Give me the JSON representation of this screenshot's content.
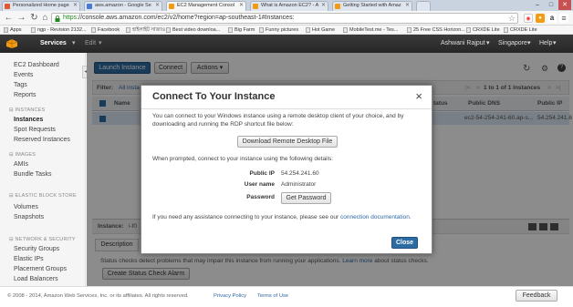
{
  "browser": {
    "tabs": [
      {
        "label": "Personalized Home page",
        "color": "#e6562f"
      },
      {
        "label": "aws.amazon - Google Se",
        "color": "#4a7bd4"
      },
      {
        "label": "EC2 Management Consol",
        "color": "#f39c12"
      },
      {
        "label": "What is Amazon EC2? - A",
        "color": "#f39c12"
      },
      {
        "label": "Getting Started with Amaz",
        "color": "#f39c12"
      }
    ],
    "window_controls": [
      "–",
      "□",
      "✕"
    ],
    "url_scheme": "https",
    "url_rest": "://console.aws.amazon.com/ec2/v2/home?region=ap-southeast-1#Instances:",
    "bookmarks": [
      "Apps",
      "ngp - Revision 2132...",
      "Facebook",
      "হাইলাইট সাজাও",
      "Best video downloa...",
      "Big Farm",
      "Funny pictures",
      "Hot Game",
      "MobileTest.me - Tes...",
      "25 Free CSS Horizon...",
      "CRXDE Lite",
      "CRXDE Lite"
    ]
  },
  "aws_nav": {
    "services": "Services",
    "edit": "Edit",
    "user": "Ashwani Rajput",
    "region": "Singapore",
    "help": "Help"
  },
  "sidebar": {
    "top_items": [
      "EC2 Dashboard",
      "Events",
      "Tags",
      "Reports"
    ],
    "sections": [
      {
        "heading": "INSTANCES",
        "items": [
          "Instances",
          "Spot Requests",
          "Reserved Instances"
        ]
      },
      {
        "heading": "IMAGES",
        "items": [
          "AMIs",
          "Bundle Tasks"
        ]
      },
      {
        "heading": "ELASTIC BLOCK STORE",
        "items": [
          "Volumes",
          "Snapshots"
        ]
      },
      {
        "heading": "NETWORK & SECURITY",
        "items": [
          "Security Groups",
          "Elastic IPs",
          "Placement Groups",
          "Load Balancers"
        ]
      }
    ],
    "selected": "Instances"
  },
  "toolbar": {
    "launch": "Launch Instance",
    "connect": "Connect",
    "actions": "Actions"
  },
  "table": {
    "filter_label": "Filter:",
    "filter_value": "All insta",
    "pagination": "1 to 1 of 1 Instances",
    "col_name": "Name",
    "col_status": "tatus",
    "col_public_dns": "Public DNS",
    "col_public_ip": "Public IP",
    "row_dns": "ec2-54-254-241-60.ap-s...",
    "row_ip": "54.254.241.6"
  },
  "detail": {
    "instance_label": "Instance:",
    "instance_value": "i-f0",
    "tab_description": "Description",
    "status_text": "Status checks detect problems that may impair this instance from running your applications.",
    "learn_more": "Learn more",
    "status_text2": "about status checks.",
    "create_alarm": "Create Status Check Alarm"
  },
  "modal": {
    "title": "Connect To Your Instance",
    "close_glyph": "×",
    "intro": "You can connect to your Windows instance using a remote desktop client of your choice, and by downloading and running the RDP shortcut file below:",
    "download_button": "Download Remote Desktop File",
    "prompt": "When prompted, connect to your instance using the following details:",
    "public_ip_label": "Public IP",
    "public_ip_value": "54.254.241.60",
    "username_label": "User name",
    "username_value": "Administrator",
    "password_label": "Password",
    "password_button": "Get Password",
    "help_text": "If you need any assistance connecting to your instance, please see our",
    "help_link": "connection documentation",
    "help_end": ".",
    "close_button": "Close"
  },
  "footer": {
    "copyright": "© 2008 - 2014, Amazon Web Services, Inc. or its affiliates. All rights reserved.",
    "privacy": "Privacy Policy",
    "terms": "Terms of Use",
    "feedback": "Feedback"
  }
}
